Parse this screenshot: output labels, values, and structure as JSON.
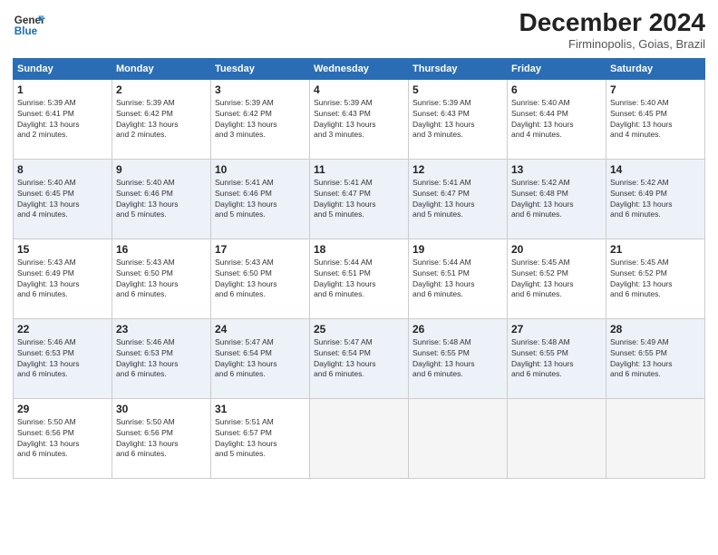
{
  "header": {
    "logo_line1": "General",
    "logo_line2": "Blue",
    "month": "December 2024",
    "location": "Firminopolis, Goias, Brazil"
  },
  "days_of_week": [
    "Sunday",
    "Monday",
    "Tuesday",
    "Wednesday",
    "Thursday",
    "Friday",
    "Saturday"
  ],
  "weeks": [
    [
      {
        "day": "1",
        "info": "Sunrise: 5:39 AM\nSunset: 6:41 PM\nDaylight: 13 hours\nand 2 minutes."
      },
      {
        "day": "2",
        "info": "Sunrise: 5:39 AM\nSunset: 6:42 PM\nDaylight: 13 hours\nand 2 minutes."
      },
      {
        "day": "3",
        "info": "Sunrise: 5:39 AM\nSunset: 6:42 PM\nDaylight: 13 hours\nand 3 minutes."
      },
      {
        "day": "4",
        "info": "Sunrise: 5:39 AM\nSunset: 6:43 PM\nDaylight: 13 hours\nand 3 minutes."
      },
      {
        "day": "5",
        "info": "Sunrise: 5:39 AM\nSunset: 6:43 PM\nDaylight: 13 hours\nand 3 minutes."
      },
      {
        "day": "6",
        "info": "Sunrise: 5:40 AM\nSunset: 6:44 PM\nDaylight: 13 hours\nand 4 minutes."
      },
      {
        "day": "7",
        "info": "Sunrise: 5:40 AM\nSunset: 6:45 PM\nDaylight: 13 hours\nand 4 minutes."
      }
    ],
    [
      {
        "day": "8",
        "info": "Sunrise: 5:40 AM\nSunset: 6:45 PM\nDaylight: 13 hours\nand 4 minutes."
      },
      {
        "day": "9",
        "info": "Sunrise: 5:40 AM\nSunset: 6:46 PM\nDaylight: 13 hours\nand 5 minutes."
      },
      {
        "day": "10",
        "info": "Sunrise: 5:41 AM\nSunset: 6:46 PM\nDaylight: 13 hours\nand 5 minutes."
      },
      {
        "day": "11",
        "info": "Sunrise: 5:41 AM\nSunset: 6:47 PM\nDaylight: 13 hours\nand 5 minutes."
      },
      {
        "day": "12",
        "info": "Sunrise: 5:41 AM\nSunset: 6:47 PM\nDaylight: 13 hours\nand 5 minutes."
      },
      {
        "day": "13",
        "info": "Sunrise: 5:42 AM\nSunset: 6:48 PM\nDaylight: 13 hours\nand 6 minutes."
      },
      {
        "day": "14",
        "info": "Sunrise: 5:42 AM\nSunset: 6:49 PM\nDaylight: 13 hours\nand 6 minutes."
      }
    ],
    [
      {
        "day": "15",
        "info": "Sunrise: 5:43 AM\nSunset: 6:49 PM\nDaylight: 13 hours\nand 6 minutes."
      },
      {
        "day": "16",
        "info": "Sunrise: 5:43 AM\nSunset: 6:50 PM\nDaylight: 13 hours\nand 6 minutes."
      },
      {
        "day": "17",
        "info": "Sunrise: 5:43 AM\nSunset: 6:50 PM\nDaylight: 13 hours\nand 6 minutes."
      },
      {
        "day": "18",
        "info": "Sunrise: 5:44 AM\nSunset: 6:51 PM\nDaylight: 13 hours\nand 6 minutes."
      },
      {
        "day": "19",
        "info": "Sunrise: 5:44 AM\nSunset: 6:51 PM\nDaylight: 13 hours\nand 6 minutes."
      },
      {
        "day": "20",
        "info": "Sunrise: 5:45 AM\nSunset: 6:52 PM\nDaylight: 13 hours\nand 6 minutes."
      },
      {
        "day": "21",
        "info": "Sunrise: 5:45 AM\nSunset: 6:52 PM\nDaylight: 13 hours\nand 6 minutes."
      }
    ],
    [
      {
        "day": "22",
        "info": "Sunrise: 5:46 AM\nSunset: 6:53 PM\nDaylight: 13 hours\nand 6 minutes."
      },
      {
        "day": "23",
        "info": "Sunrise: 5:46 AM\nSunset: 6:53 PM\nDaylight: 13 hours\nand 6 minutes."
      },
      {
        "day": "24",
        "info": "Sunrise: 5:47 AM\nSunset: 6:54 PM\nDaylight: 13 hours\nand 6 minutes."
      },
      {
        "day": "25",
        "info": "Sunrise: 5:47 AM\nSunset: 6:54 PM\nDaylight: 13 hours\nand 6 minutes."
      },
      {
        "day": "26",
        "info": "Sunrise: 5:48 AM\nSunset: 6:55 PM\nDaylight: 13 hours\nand 6 minutes."
      },
      {
        "day": "27",
        "info": "Sunrise: 5:48 AM\nSunset: 6:55 PM\nDaylight: 13 hours\nand 6 minutes."
      },
      {
        "day": "28",
        "info": "Sunrise: 5:49 AM\nSunset: 6:55 PM\nDaylight: 13 hours\nand 6 minutes."
      }
    ],
    [
      {
        "day": "29",
        "info": "Sunrise: 5:50 AM\nSunset: 6:56 PM\nDaylight: 13 hours\nand 6 minutes."
      },
      {
        "day": "30",
        "info": "Sunrise: 5:50 AM\nSunset: 6:56 PM\nDaylight: 13 hours\nand 6 minutes."
      },
      {
        "day": "31",
        "info": "Sunrise: 5:51 AM\nSunset: 6:57 PM\nDaylight: 13 hours\nand 5 minutes."
      },
      {
        "day": "",
        "info": ""
      },
      {
        "day": "",
        "info": ""
      },
      {
        "day": "",
        "info": ""
      },
      {
        "day": "",
        "info": ""
      }
    ]
  ]
}
